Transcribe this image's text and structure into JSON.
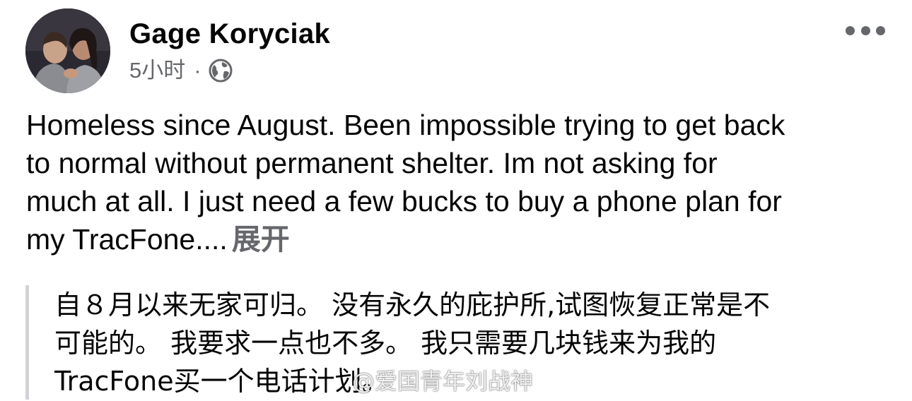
{
  "post": {
    "author": "Gage Koryciak",
    "time": "5小时",
    "separator": "·",
    "privacy_icon": "globe-icon",
    "more_icon": "more-options-icon",
    "text_lines": [
      "Homeless since August. Been impossible trying to get back",
      "to normal without permanent shelter. Im not asking for",
      "much at all. I just need a few bucks to buy a phone plan for",
      "my TracFone...."
    ],
    "expand_label": "展开",
    "translation_lines": [
      "自８月以来无家可归。 没有永久的庇护所,试图恢复正常是不",
      "可能的。 我要求一点也不多。 我只需要几块钱来为我的",
      "TracFone买一个电话计划。"
    ],
    "watermark": "@爱国青年刘战神"
  },
  "colors": {
    "text": "#050505",
    "secondary": "#65676b",
    "quote_bar": "#d0d2d6"
  }
}
